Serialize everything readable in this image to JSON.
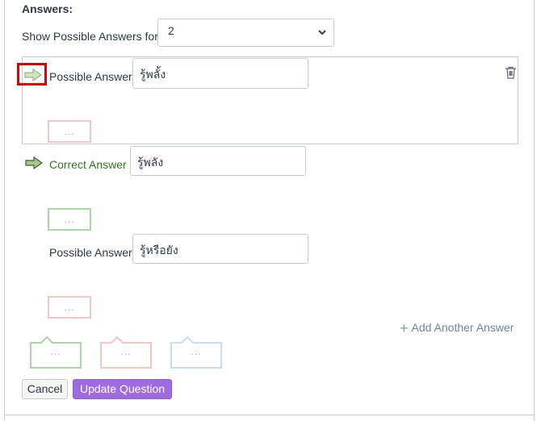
{
  "answers_title": "Answers:",
  "show_possible": {
    "label": "Show Possible Answers for",
    "selected": "2"
  },
  "answers": [
    {
      "label": "Possible Answer",
      "value": "รู้พลั้ง"
    },
    {
      "label": "Correct Answer",
      "value": "รู้พลัง"
    },
    {
      "label": "Possible Answer",
      "value": "รู้หรือยัง"
    }
  ],
  "placeholder_dots": "...",
  "add_another_answer": "Add Another Answer",
  "buttons": {
    "cancel": "Cancel",
    "update": "Update Question"
  },
  "colors": {
    "correct_label": "#2c7a1a",
    "accent_purple": "#a06be0",
    "highlight_red": "#e00000"
  }
}
